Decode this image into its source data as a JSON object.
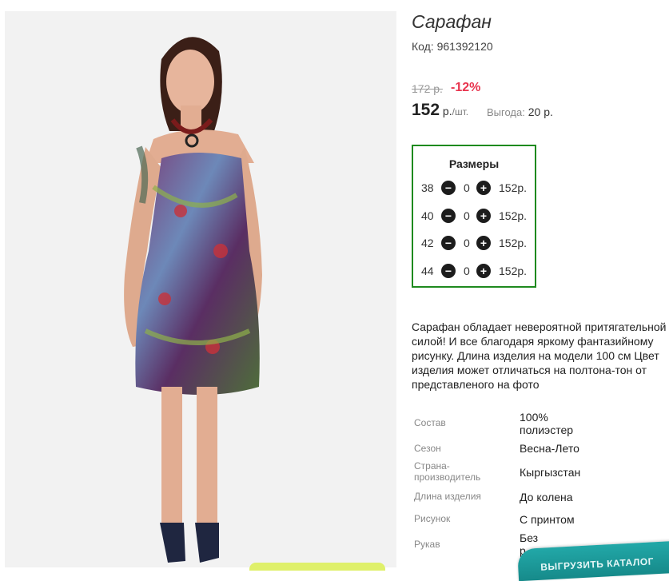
{
  "product": {
    "title": "Сарафан",
    "sku": "Код: 961392120",
    "old_price": "172 р.",
    "discount": "-12%",
    "price_value": "152",
    "price_unit": " р.",
    "price_per": "/шт.",
    "benefit_label": "Выгода:",
    "benefit_value": " 20 р."
  },
  "sizes": {
    "title": "Размеры",
    "minus_icon": "−",
    "plus_icon": "+",
    "rows": [
      {
        "size": "38",
        "qty": "0",
        "price": "152р."
      },
      {
        "size": "40",
        "qty": "0",
        "price": "152р."
      },
      {
        "size": "42",
        "qty": "0",
        "price": "152р."
      },
      {
        "size": "44",
        "qty": "0",
        "price": "152р."
      }
    ]
  },
  "description": "Сарафан обладает невероятной притягательной\nсилой! И все благодаря яркому фантазийному\nрисунку. Длина изделия на модели 100 см Цвет\nизделия может отличаться на полтона-тон от\nпредставленого на фото",
  "specs": [
    {
      "label": "Состав",
      "value": "100%\nполиэстер"
    },
    {
      "label": "Сезон",
      "value": "Весна-Лето"
    },
    {
      "label": "Страна-\nпроизводитель",
      "value": "Кыргызстан"
    },
    {
      "label": "Длина изделия",
      "value": "До колена"
    },
    {
      "label": "Рисунок",
      "value": "С принтом"
    },
    {
      "label": "Рукав",
      "value": "Без\nр"
    }
  ],
  "catalog_button": "ВЫГРУЗИТЬ  КАТАЛОГ",
  "colors": {
    "discount": "#e8344e",
    "sizes_border": "#1e8a1e",
    "catalog_button": "#1a9a9a"
  }
}
